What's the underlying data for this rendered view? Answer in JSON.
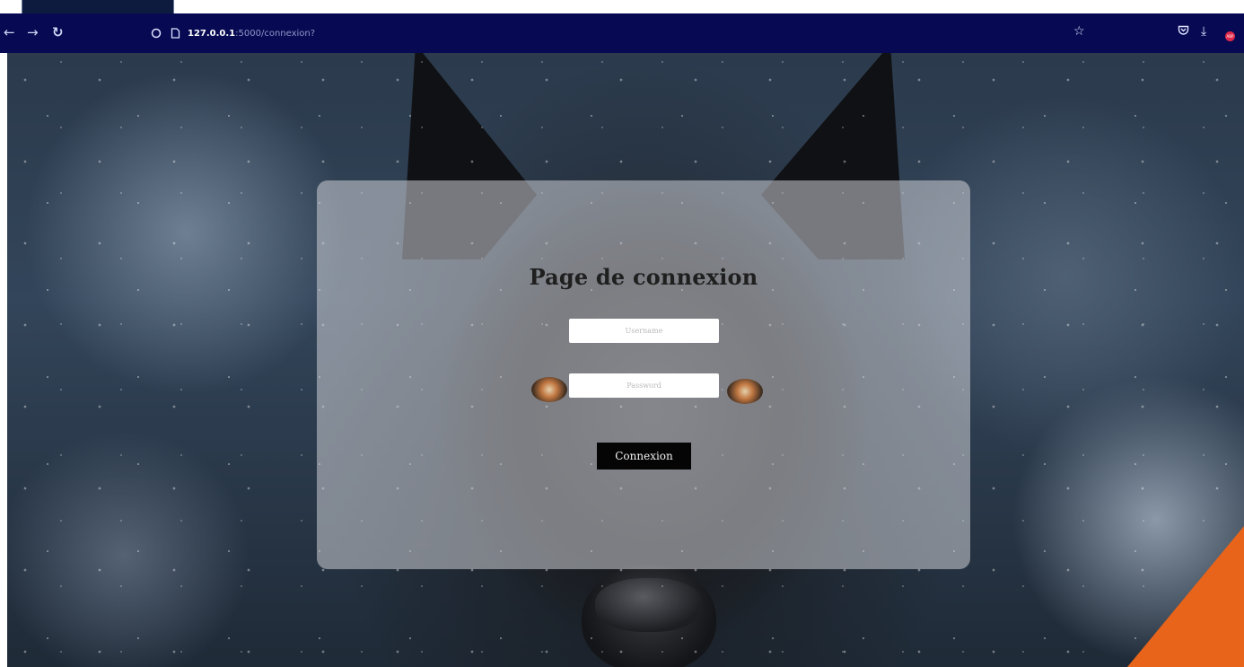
{
  "browser": {
    "url_host": "127.0.0.1",
    "url_path": ":5000/connexion?",
    "icons": {
      "back": "arrow-left-icon",
      "forward": "arrow-right-icon",
      "reload": "reload-icon",
      "shield": "shield-icon",
      "page": "page-icon",
      "bookmark": "star-icon",
      "pocket": "pocket-icon",
      "download": "download-icon",
      "adblock": "adblock-icon"
    },
    "toolbar_color": "#070a52"
  },
  "login": {
    "title": "Page de connexion",
    "username_placeholder": "Username",
    "password_placeholder": "Password",
    "submit_label": "Connexion"
  },
  "colors": {
    "accent_corner": "#e8641a",
    "button_bg": "#050505"
  }
}
